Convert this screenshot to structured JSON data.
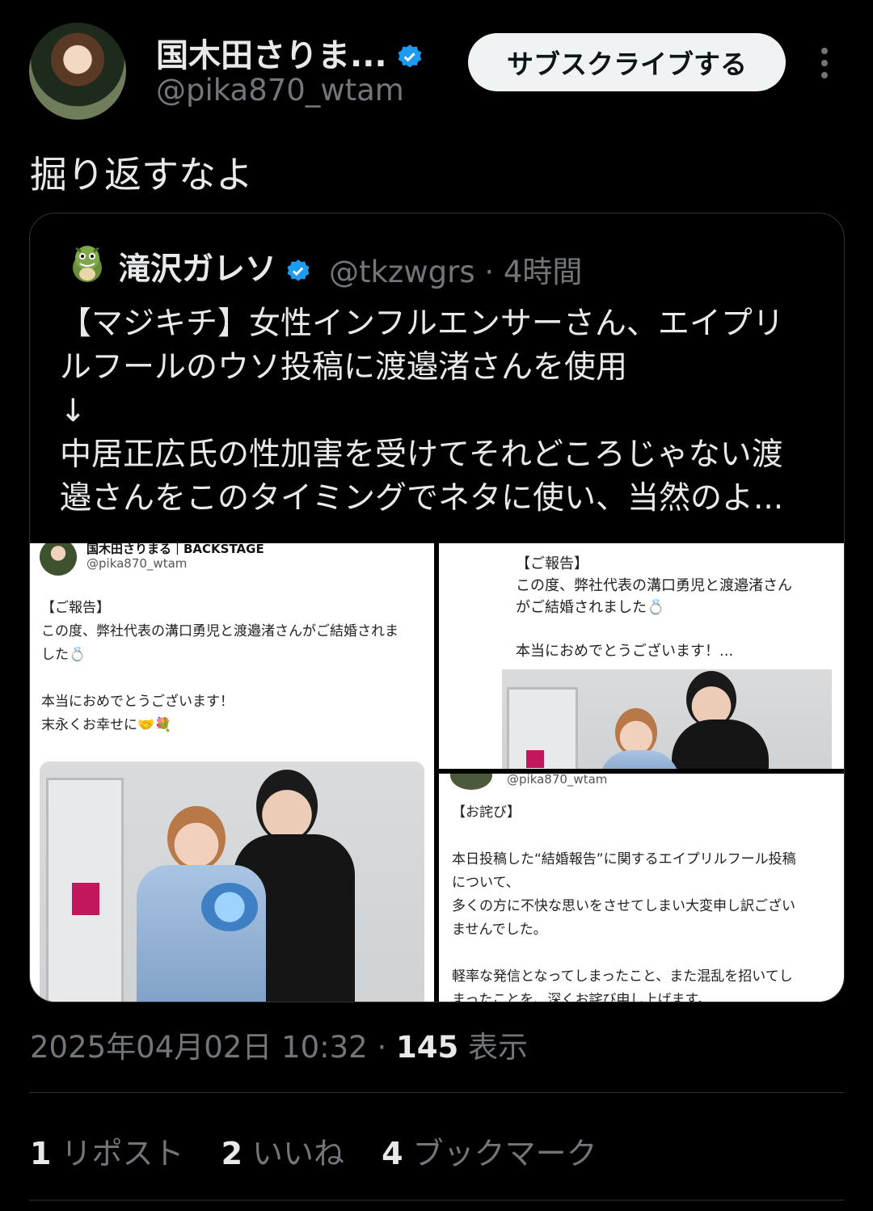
{
  "author": {
    "name": "国木田さりま...",
    "handle": "@pika870_wtam",
    "subscribe_label": "サブスクライブする"
  },
  "tweet": {
    "text": "掘り返すなよ",
    "timestamp": "2025年04月02日 10:32",
    "views_count": "145",
    "views_label": "表示"
  },
  "quote": {
    "name": "滝沢ガレソ",
    "handle": "@tkzwgrs",
    "time": "4時間",
    "lines": [
      "【マジキチ】女性インフルエンサーさん、エイプリ",
      "ルフールのウソ投稿に渡邉渚さんを使用",
      "↓",
      "中居正広氏の性加害を受けてそれどころじゃない渡",
      "邉さんをこのタイミングでネタに使い、当然のよ..."
    ],
    "media": {
      "panel1": {
        "name": "国木田さりまる｜BACKSTAGE",
        "handle": "@pika870_wtam",
        "lines": [
          "【ご報告】",
          "この度、弊社代表の溝口勇児と渡邉渚さんがご結婚されま",
          "した💍",
          "",
          "本当におめでとうございます！",
          "末永くお幸せに🤝💐"
        ]
      },
      "panel2": {
        "lines": [
          "【ご報告】",
          "この度、弊社代表の溝口勇児と渡邉渚さん",
          "がご結婚されました💍",
          "",
          "本当におめでとうございます！..."
        ]
      },
      "panel3": {
        "handle": "@pika870_wtam",
        "lines": [
          "【お詫び】",
          "",
          "本日投稿した“結婚報告”に関するエイプリルフール投稿",
          "について、",
          "多くの方に不快な思いをさせてしまい大変申し訳ござい",
          "ませんでした。",
          "",
          "軽率な発信となってしまったこと、また混乱を招いてし",
          "まったことを、深くお詫び申し上げます。"
        ]
      }
    }
  },
  "stats": {
    "reposts_count": "1",
    "reposts_label": "リポスト",
    "likes_count": "2",
    "likes_label": "いいね",
    "bookmarks_count": "4",
    "bookmarks_label": "ブックマーク"
  },
  "colors": {
    "background": "#000000",
    "text": "#e7e9ea",
    "muted": "#71767b",
    "verified": "#1d9bf0",
    "border": "#2f3336"
  },
  "icons": [
    "verified-badge-icon",
    "more-options-icon"
  ]
}
